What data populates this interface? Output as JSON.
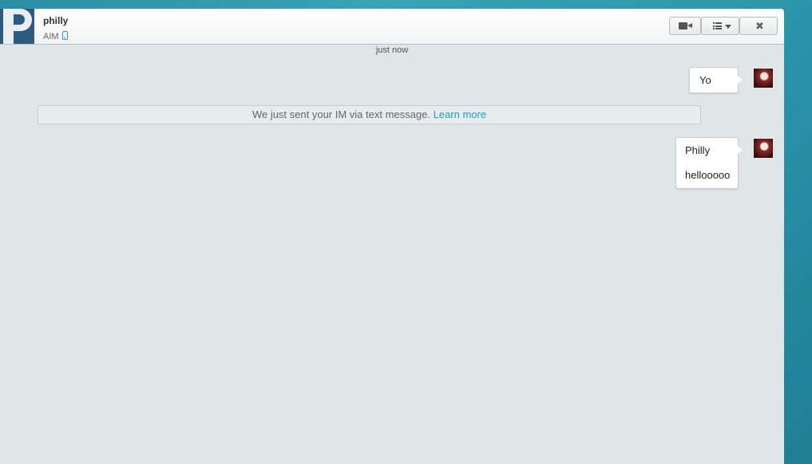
{
  "header": {
    "contact_name": "philly",
    "service": "AIM",
    "icons": {
      "avatar": "contact-avatar-p-logo",
      "device": "mobile-phone-icon",
      "video": "video-camera-icon",
      "menu": "list-menu-icon",
      "dropdown": "caret-down-icon",
      "close": "close-icon"
    },
    "close_glyph": "✖"
  },
  "conversation": {
    "timestamp": "just now",
    "messages": [
      {
        "sender": "me",
        "lines": [
          "Yo"
        ]
      },
      {
        "sender": "me",
        "lines": [
          "Philly",
          "hellooooo"
        ]
      }
    ],
    "notice": {
      "text": "We just sent your IM via text message.",
      "link": "Learn more"
    }
  },
  "colors": {
    "link": "#1b9fc0",
    "mobile_icon": "#2a96d6",
    "background": "#2a8fa6",
    "chat_area": "#e0e5e8"
  }
}
